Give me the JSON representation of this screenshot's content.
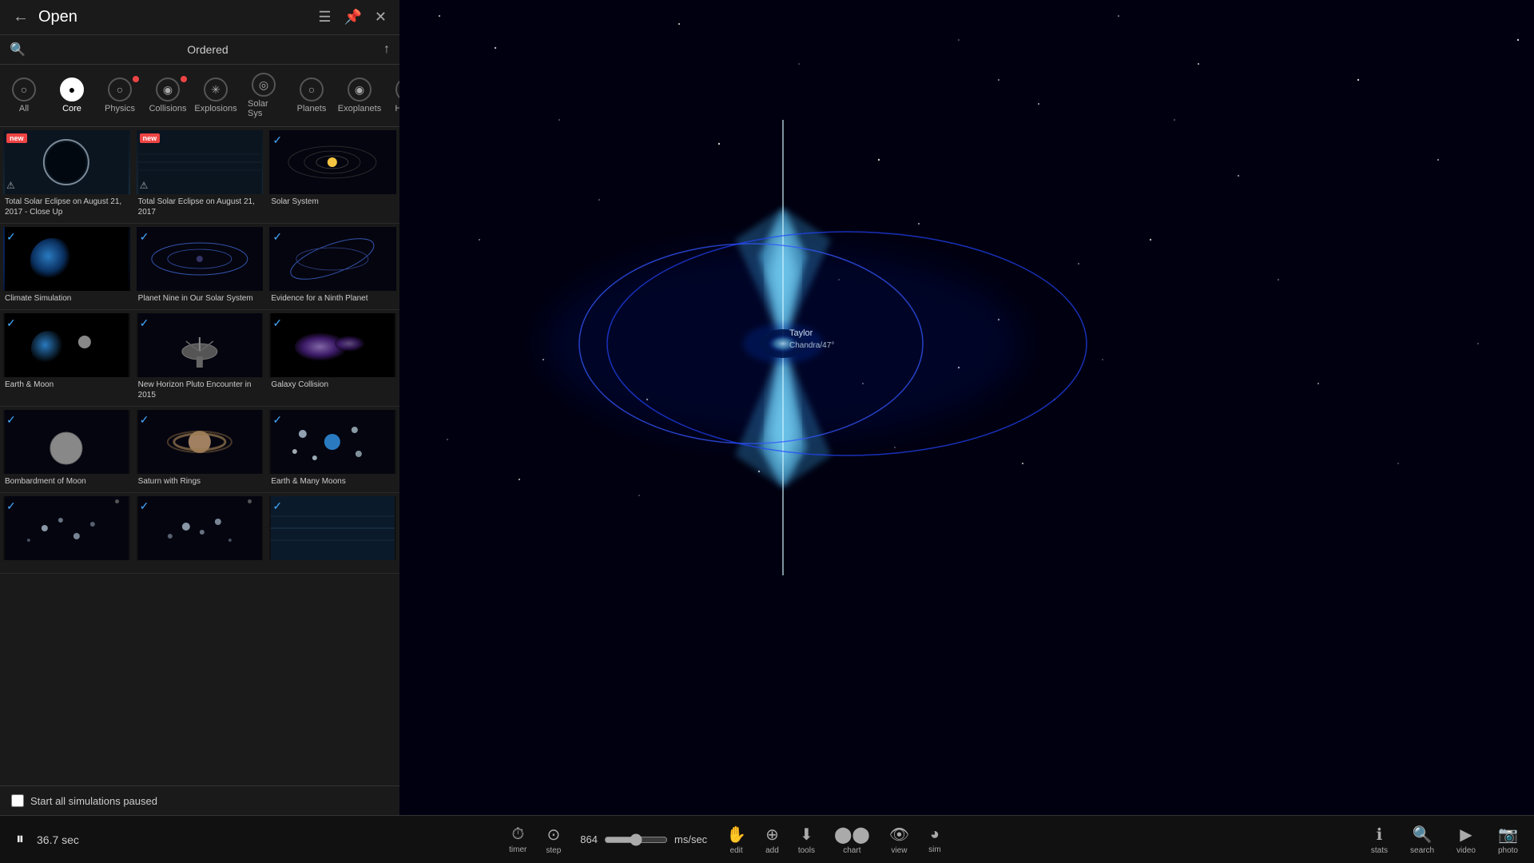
{
  "header": {
    "back_label": "←",
    "title": "Open",
    "list_icon": "☰",
    "pin_icon": "📌",
    "close_icon": "✕"
  },
  "search": {
    "icon": "🔍",
    "ordered_label": "Ordered",
    "up_icon": "↑"
  },
  "categories": [
    {
      "id": "all",
      "label": "All",
      "icon": "○",
      "active": false,
      "dot": false
    },
    {
      "id": "core",
      "label": "Core",
      "icon": "●",
      "active": true,
      "dot": false
    },
    {
      "id": "physics",
      "label": "Physics",
      "icon": "○",
      "active": false,
      "dot": true
    },
    {
      "id": "collisions",
      "label": "Collisions",
      "icon": "◉",
      "active": false,
      "dot": true
    },
    {
      "id": "explosions",
      "label": "Explosions",
      "icon": "✳",
      "active": false,
      "dot": false
    },
    {
      "id": "solar-sys",
      "label": "Solar Sys",
      "icon": "◎",
      "active": false,
      "dot": false
    },
    {
      "id": "planets",
      "label": "Planets",
      "icon": "○",
      "active": false,
      "dot": false
    },
    {
      "id": "exoplanets",
      "label": "Exoplanets",
      "icon": "◉",
      "active": false,
      "dot": false
    },
    {
      "id": "histori",
      "label": "Histori",
      "icon": "⏱",
      "active": false,
      "dot": false
    }
  ],
  "simulations": [
    {
      "row": 0,
      "items": [
        {
          "id": "eclipse-closeup",
          "title": "Total Solar Eclipse on August 21, 2017 - Close Up",
          "badge": "new",
          "check": false,
          "thumb": "eclipse"
        },
        {
          "id": "eclipse",
          "title": "Total Solar Eclipse on August 21, 2017",
          "badge": "new",
          "check": false,
          "thumb": "eclipse2"
        },
        {
          "id": "solar-system",
          "title": "Solar System",
          "badge": null,
          "check": true,
          "thumb": "solar-system"
        }
      ]
    },
    {
      "row": 1,
      "items": [
        {
          "id": "climate",
          "title": "Climate Simulation",
          "badge": null,
          "check": true,
          "thumb": "climate"
        },
        {
          "id": "planet9",
          "title": "Planet Nine in Our Solar System",
          "badge": null,
          "check": true,
          "thumb": "planet9"
        },
        {
          "id": "evidence",
          "title": "Evidence for a Ninth Planet",
          "badge": null,
          "check": true,
          "thumb": "evidence"
        }
      ]
    },
    {
      "row": 2,
      "items": [
        {
          "id": "earth-moon",
          "title": "Earth & Moon",
          "badge": null,
          "check": true,
          "thumb": "earth-moon"
        },
        {
          "id": "new-horizon",
          "title": "New Horizon Pluto Encounter in 2015",
          "badge": null,
          "check": true,
          "thumb": "new-horizon"
        },
        {
          "id": "galaxy",
          "title": "Galaxy Collision",
          "badge": null,
          "check": true,
          "thumb": "galaxy"
        }
      ]
    },
    {
      "row": 3,
      "items": [
        {
          "id": "bombardment",
          "title": "Bombardment of Moon",
          "badge": null,
          "check": true,
          "thumb": "bombardment"
        },
        {
          "id": "saturn",
          "title": "Saturn with Rings",
          "badge": null,
          "check": true,
          "thumb": "saturn"
        },
        {
          "id": "many-moons",
          "title": "Earth & Many Moons",
          "badge": null,
          "check": true,
          "thumb": "many-moons"
        }
      ]
    },
    {
      "row": 4,
      "items": [
        {
          "id": "cluster1",
          "title": "",
          "badge": null,
          "check": true,
          "thumb": "cluster1"
        },
        {
          "id": "cluster2",
          "title": "",
          "badge": null,
          "check": true,
          "thumb": "cluster2"
        },
        {
          "id": "cluster3",
          "title": "",
          "badge": null,
          "check": true,
          "thumb": "cluster3"
        }
      ]
    }
  ],
  "footer": {
    "checkbox_label": "Start all simulations paused",
    "checked": false
  },
  "bottom_toolbar": {
    "play_pause": "⏸",
    "time": "36.7 sec",
    "timer_label": "timer",
    "step_label": "step",
    "speed_value": "864",
    "speed_unit": "ms/sec",
    "tools": [
      {
        "id": "edit",
        "icon": "✋",
        "label": "edit"
      },
      {
        "id": "add",
        "icon": "+",
        "label": "add"
      },
      {
        "id": "tools",
        "icon": "⬇",
        "label": "tools"
      },
      {
        "id": "chart",
        "icon": "⬤⬤⬤",
        "label": "chart"
      },
      {
        "id": "view",
        "icon": "👁",
        "label": "view"
      },
      {
        "id": "sim",
        "icon": "◕",
        "label": "sim"
      },
      {
        "id": "stats",
        "icon": "ℹ",
        "label": "stats"
      },
      {
        "id": "search",
        "icon": "🔍",
        "label": "search"
      },
      {
        "id": "video",
        "icon": "▶",
        "label": "video"
      },
      {
        "id": "photo",
        "icon": "📷",
        "label": "photo"
      }
    ]
  },
  "space_view": {
    "label": "Taylor",
    "sublabel": "Chandra/47°"
  }
}
